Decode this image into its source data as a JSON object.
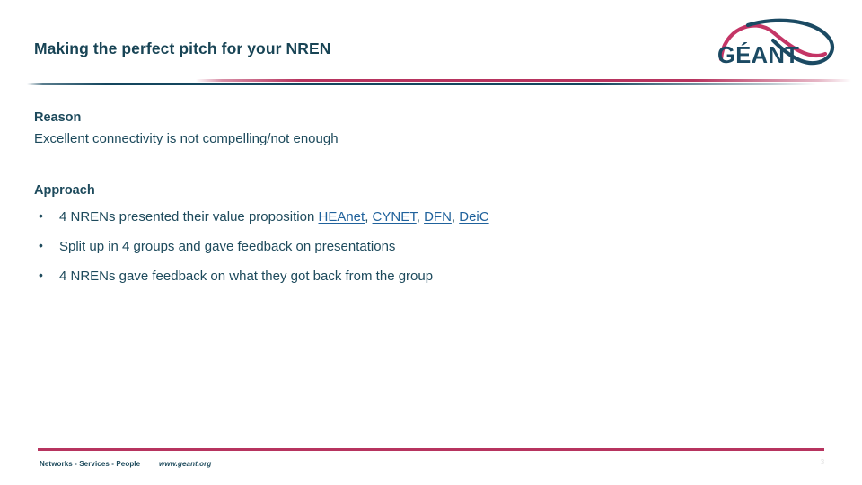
{
  "slide": {
    "title": "Making the perfect pitch for your NREN",
    "page_number": "3"
  },
  "logo": {
    "wordmark": "GÉANT",
    "swoosh_magenta_color": "#c43566",
    "swoosh_navy_color": "#1b4a63"
  },
  "divider": {
    "magenta_color": "#b7345f",
    "navy_color": "#14465e"
  },
  "body": {
    "reason": {
      "heading": "Reason",
      "text": "Excellent connectivity is not compelling/not enough"
    },
    "approach": {
      "heading": "Approach",
      "bullets": [
        {
          "prefix": "4 NRENs presented their value proposition ",
          "links": [
            {
              "label": "HEAnet",
              "separator": ", "
            },
            {
              "label": "CYNET",
              "separator": ", "
            },
            {
              "label": "DFN",
              "separator": ", "
            },
            {
              "label": "DeiC",
              "separator": ""
            }
          ],
          "suffix": ""
        },
        {
          "prefix": "Split up in 4 groups and gave feedback on presentations",
          "links": [],
          "suffix": ""
        },
        {
          "prefix": "4 NRENs gave feedback on what they got back from the group",
          "links": [],
          "suffix": ""
        }
      ]
    }
  },
  "footer": {
    "tagline": "Networks - Services - People",
    "url": "www.geant.org",
    "rule_color": "#b7345f"
  },
  "colors": {
    "text_navy": "#1d4a5c",
    "title_navy": "#184455",
    "link_blue": "#20629c",
    "magenta": "#b7345f",
    "background": "#ffffff"
  }
}
